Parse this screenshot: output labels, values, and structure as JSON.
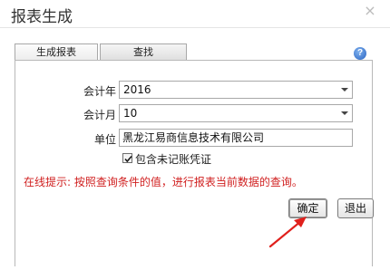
{
  "dialog": {
    "title": "报表生成",
    "close_glyph": "×"
  },
  "tabs": [
    {
      "label": "生成报表",
      "active": true
    },
    {
      "label": "查找",
      "active": false
    }
  ],
  "help": {
    "glyph": "?",
    "icon": "help-icon"
  },
  "form": {
    "year_label": "会计年",
    "year_value": "2016",
    "month_label": "会计月",
    "month_value": "10",
    "unit_label": "单位",
    "unit_value": "黑龙江易商信息技术有限公司",
    "include_unposted_label": "包含未记账凭证",
    "include_unposted_checked": true
  },
  "hint": "在线提示: 按照查询条件的值，进行报表当前数据的查询。",
  "buttons": {
    "ok_label": "确定",
    "exit_label": "退出"
  },
  "colors": {
    "hint": "#d01f1f",
    "annotation_arrow": "#e0201c",
    "help_icon": "#2a64c2"
  }
}
